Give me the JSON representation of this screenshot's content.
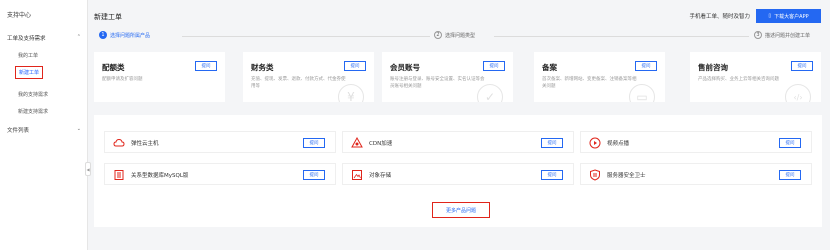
{
  "sidebar": {
    "title": "支持中心",
    "group1": "工单及支持需求",
    "items": [
      "我的工单",
      "新建工单",
      "我的支持需求",
      "新建支持需求"
    ],
    "group2": "文件列表"
  },
  "header": {
    "title": "新建工单",
    "hint": "手机看工单、随时及智力",
    "app_button": "下载大客户APP"
  },
  "steps": [
    {
      "num": "1",
      "label": "选择问题所属产品"
    },
    {
      "num": "2",
      "label": "选择问题类型"
    },
    {
      "num": "3",
      "label": "描述问题并创建工单"
    }
  ],
  "categories": [
    {
      "name": "配额类",
      "desc": "配额申请及扩容问题",
      "button": "提问",
      "deco": "⊞"
    },
    {
      "name": "财务类",
      "desc": "充值、提现、发票、退款、付款方式、代金券使用等",
      "button": "提问",
      "deco": "¥"
    },
    {
      "name": "会员账号",
      "desc": "账号注册与登录、账号安全设置、实名认证等会员账号相关问题",
      "button": "提问",
      "deco": "✓"
    },
    {
      "name": "备案",
      "desc": "首次备案、新增网站、变更备案、注销备案等相关问题",
      "button": "提问",
      "deco": "▭"
    },
    {
      "name": "售前咨询",
      "desc": "产品选择购买、业务上云等相关咨询问题",
      "button": "提问",
      "deco": "‹/›"
    }
  ],
  "products": [
    {
      "name": "弹性云主机",
      "button": "提问",
      "icon": "cloud-server-icon"
    },
    {
      "name": "CDN加速",
      "button": "提问",
      "icon": "cdn-icon"
    },
    {
      "name": "视频点播",
      "button": "提问",
      "icon": "video-icon"
    },
    {
      "name": "关系型数据库MySQL版",
      "button": "提问",
      "icon": "database-icon"
    },
    {
      "name": "对象存储",
      "button": "提问",
      "icon": "storage-icon"
    },
    {
      "name": "服务器安全卫士",
      "button": "提问",
      "icon": "security-icon"
    }
  ],
  "more_button": "更多产品问题",
  "colors": {
    "primary": "#2468f2",
    "highlight": "#e0251b"
  }
}
